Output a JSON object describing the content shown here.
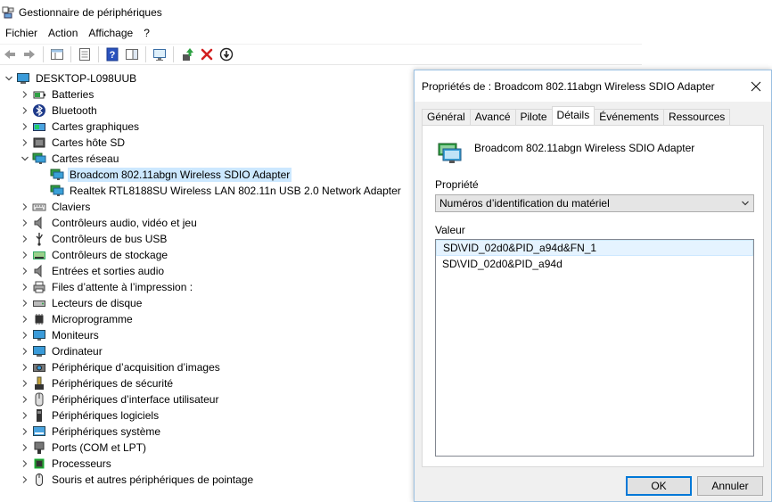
{
  "window": {
    "title": "Gestionnaire de périphériques"
  },
  "menu": [
    "Fichier",
    "Action",
    "Affichage",
    "?"
  ],
  "tree": {
    "root": "DESKTOP-L098UUB",
    "categories": [
      {
        "label": "Batteries",
        "icon": "battery-icon"
      },
      {
        "label": "Bluetooth",
        "icon": "bluetooth-icon"
      },
      {
        "label": "Cartes graphiques",
        "icon": "display-adapter-icon"
      },
      {
        "label": "Cartes hôte SD",
        "icon": "sd-host-icon"
      },
      {
        "label": "Cartes réseau",
        "icon": "network-adapter-icon",
        "expanded": true,
        "children": [
          {
            "label": "Broadcom 802.11abgn Wireless SDIO Adapter",
            "selected": true
          },
          {
            "label": "Realtek RTL8188SU Wireless LAN 802.11n USB 2.0 Network Adapter"
          }
        ]
      },
      {
        "label": "Claviers",
        "icon": "keyboard-icon"
      },
      {
        "label": "Contrôleurs audio, vidéo et jeu",
        "icon": "speaker-icon"
      },
      {
        "label": "Contrôleurs de bus USB",
        "icon": "usb-icon"
      },
      {
        "label": "Contrôleurs de stockage",
        "icon": "storage-controller-icon"
      },
      {
        "label": "Entrées et sorties audio",
        "icon": "speaker-icon"
      },
      {
        "label": "Files d’attente à l’impression :",
        "icon": "printer-icon"
      },
      {
        "label": "Lecteurs de disque",
        "icon": "disk-drive-icon"
      },
      {
        "label": "Microprogramme",
        "icon": "chip-icon"
      },
      {
        "label": "Moniteurs",
        "icon": "monitor-icon"
      },
      {
        "label": "Ordinateur",
        "icon": "computer-icon"
      },
      {
        "label": "Périphérique d’acquisition d’images",
        "icon": "camera-icon"
      },
      {
        "label": "Périphériques de sécurité",
        "icon": "security-icon"
      },
      {
        "label": "Périphériques d’interface utilisateur",
        "icon": "hid-icon"
      },
      {
        "label": "Périphériques logiciels",
        "icon": "software-device-icon"
      },
      {
        "label": "Périphériques système",
        "icon": "system-device-icon"
      },
      {
        "label": "Ports (COM et LPT)",
        "icon": "port-icon"
      },
      {
        "label": "Processeurs",
        "icon": "processor-icon"
      },
      {
        "label": "Souris et autres périphériques de pointage",
        "icon": "mouse-icon"
      }
    ]
  },
  "dialog": {
    "title": "Propriétés de : Broadcom 802.11abgn Wireless SDIO Adapter",
    "tabs": [
      "Général",
      "Avancé",
      "Pilote",
      "Détails",
      "Événements",
      "Ressources"
    ],
    "active_tab": "Détails",
    "device_name": "Broadcom 802.11abgn Wireless SDIO Adapter",
    "property_label": "Propriété",
    "property_value": "Numéros d’identification du matériel",
    "value_label": "Valeur",
    "values": [
      "SD\\VID_02d0&PID_a94d&FN_1",
      "SD\\VID_02d0&PID_a94d"
    ],
    "ok": "OK",
    "cancel": "Annuler"
  }
}
